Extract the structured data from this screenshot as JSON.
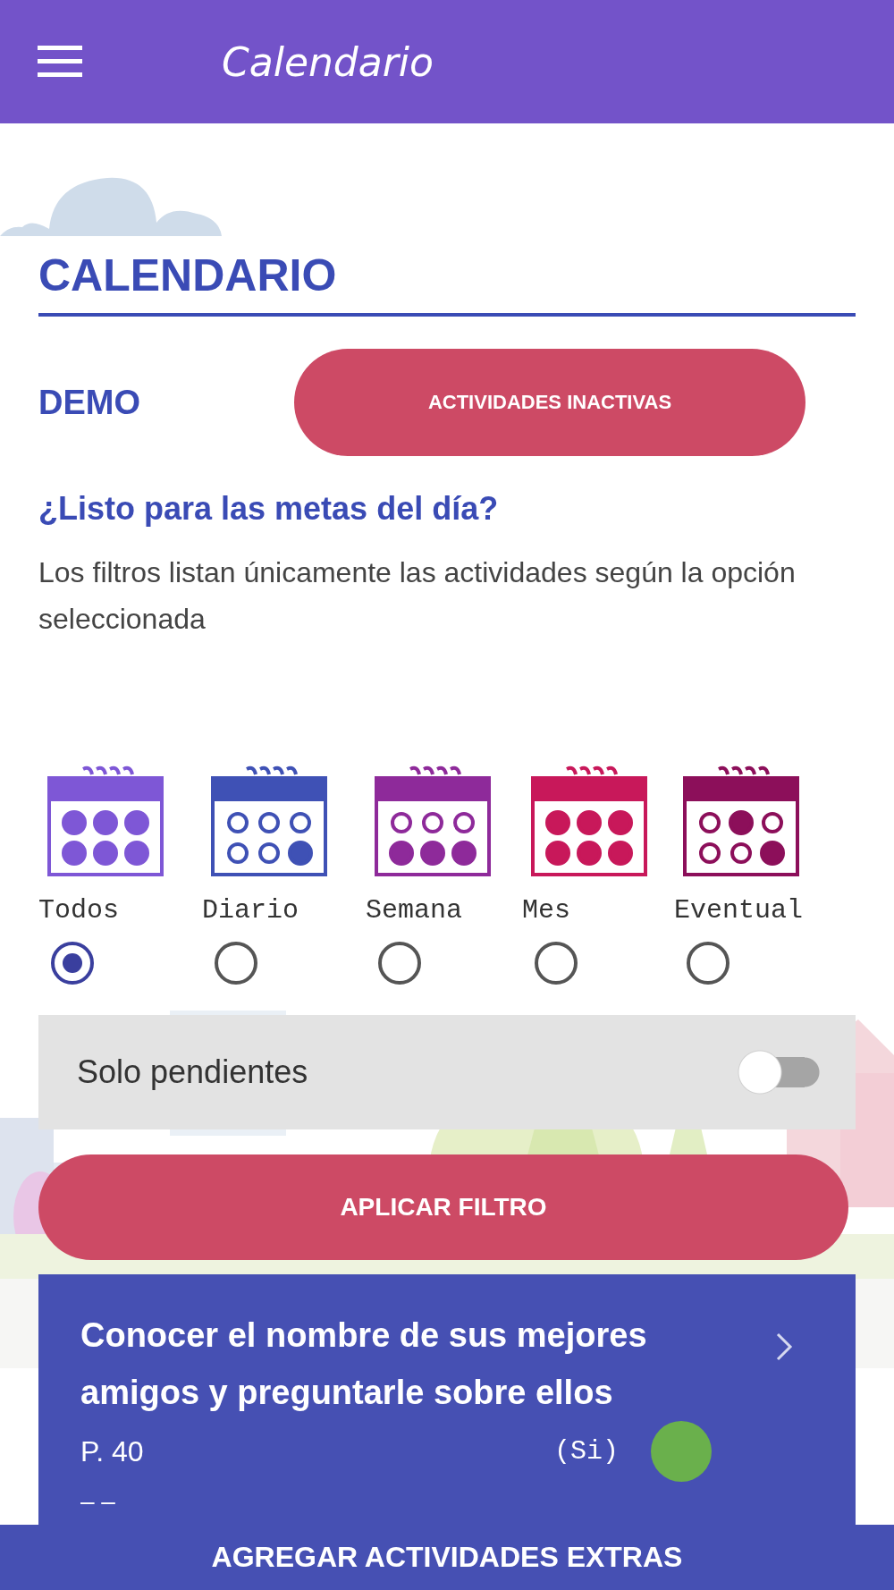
{
  "app_bar": {
    "title": "Calendario"
  },
  "heading": "CALENDARIO",
  "profile": {
    "name": "DEMO",
    "button": "ACTIVIDADES INACTIVAS"
  },
  "question": "¿Listo para las metas del día?",
  "description": "Los filtros listan únicamente las actividades según la opción seleccionada",
  "filters": [
    {
      "label": "Todos",
      "color": "#7e57d6",
      "selected": true
    },
    {
      "label": "Diario",
      "color": "#3f51b5",
      "selected": false
    },
    {
      "label": "Semana",
      "color": "#8e2a9a",
      "selected": false
    },
    {
      "label": "Mes",
      "color": "#c8185a",
      "selected": false
    },
    {
      "label": "Eventual",
      "color": "#8c0f5a",
      "selected": false
    }
  ],
  "pending_only": {
    "label": "Solo pendientes",
    "on": false
  },
  "apply_button": "APLICAR FILTRO",
  "activity": {
    "title": "Conocer el nombre de sus mejores amigos y preguntarle sobre ellos",
    "points": "P. 40",
    "answer": "(Si)",
    "color": "#6ab04c",
    "extra": "– –"
  },
  "bottom_button": "AGREGAR ACTIVIDADES EXTRAS"
}
